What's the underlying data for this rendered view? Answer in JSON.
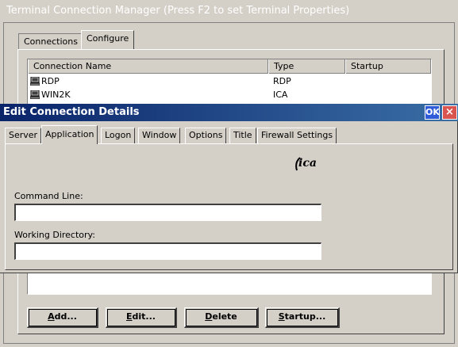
{
  "main_window": {
    "title": "Terminal Connection Manager (Press F2 to set Terminal Properties)",
    "tabs": [
      {
        "label": "Connections"
      },
      {
        "label": "Configure"
      }
    ],
    "list": {
      "columns": [
        "Connection Name",
        "Type",
        "Startup"
      ],
      "rows": [
        {
          "name": "RDP",
          "type": "RDP",
          "startup": ""
        },
        {
          "name": "WIN2K",
          "type": "ICA",
          "startup": ""
        }
      ]
    },
    "buttons": {
      "add": {
        "accel": "A",
        "rest": "dd..."
      },
      "edit": {
        "accel": "E",
        "rest": "dit..."
      },
      "delete": {
        "accel": "D",
        "rest": "elete"
      },
      "startup": {
        "accel": "S",
        "rest": "tartup..."
      }
    }
  },
  "dialog": {
    "title": "Edit Connection Details",
    "ok_label": "OK",
    "close_label": "×",
    "tabs": [
      {
        "label": "Server"
      },
      {
        "label": "Application"
      },
      {
        "label": "Logon"
      },
      {
        "label": "Window"
      },
      {
        "label": "Options"
      },
      {
        "label": "Title"
      },
      {
        "label": "Firewall Settings"
      }
    ],
    "logo_text": "ica",
    "command_line": {
      "label": "Command Line:",
      "value": ""
    },
    "working_directory": {
      "label": "Working Directory:",
      "value": ""
    }
  },
  "colors": {
    "dialog_title_bg": "#0a246a",
    "window_bg": "#d4d0c8",
    "close_button": "#d9534f",
    "ok_button": "#2f5bd8"
  },
  "icons": {
    "connection_icon": "computer-icon",
    "logo": "ica-logo"
  }
}
